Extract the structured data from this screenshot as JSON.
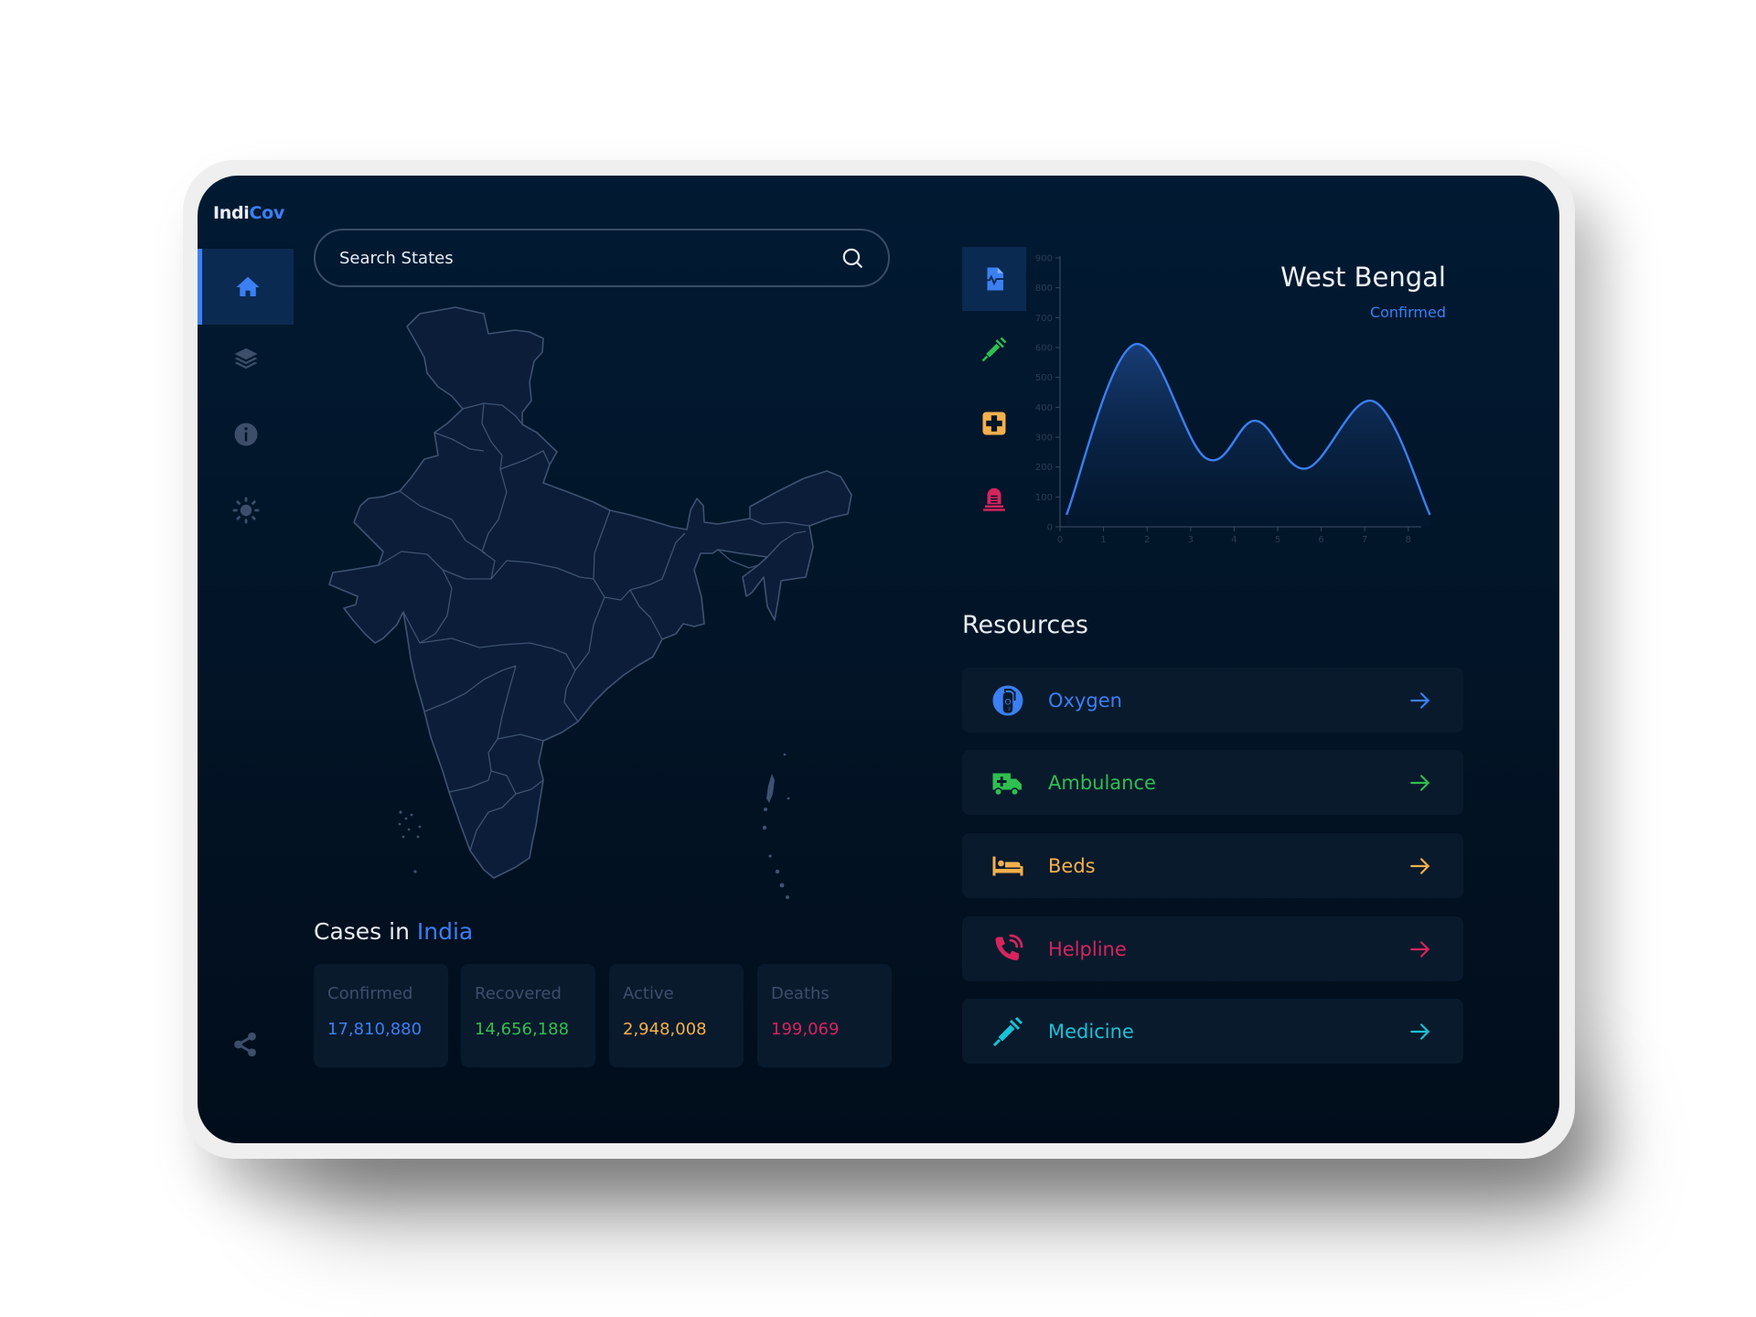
{
  "app": {
    "logo_prefix": "Indi",
    "logo_accent": "Cov"
  },
  "sidebar": {
    "items": [
      {
        "name": "home",
        "icon": "home-icon",
        "active": true
      },
      {
        "name": "layers",
        "icon": "layers-icon",
        "active": false
      },
      {
        "name": "info",
        "icon": "info-icon",
        "active": false
      },
      {
        "name": "theme",
        "icon": "sun-icon",
        "active": false
      }
    ],
    "footer_icon": "share-icon"
  },
  "search": {
    "placeholder": "Search States",
    "value": ""
  },
  "cases": {
    "title_prefix": "Cases in ",
    "title_accent": "India",
    "stats": [
      {
        "label": "Confirmed",
        "value": "17,810,880",
        "color": "#3b7ff2"
      },
      {
        "label": "Recovered",
        "value": "14,656,188",
        "color": "#2fbf4f"
      },
      {
        "label": "Active",
        "value": "2,948,008",
        "color": "#f5b04d"
      },
      {
        "label": "Deaths",
        "value": "199,069",
        "color": "#d6245e"
      }
    ]
  },
  "chart_tabs": [
    {
      "name": "confirmed",
      "icon": "medical-report-icon",
      "color": "#3b7ff2",
      "active": true
    },
    {
      "name": "vaccinated",
      "icon": "syringe-icon",
      "color": "#2fbf4f",
      "active": false
    },
    {
      "name": "active",
      "icon": "first-aid-icon",
      "color": "#f5b04d",
      "active": false
    },
    {
      "name": "deaths",
      "icon": "tombstone-icon",
      "color": "#d6245e",
      "active": false
    }
  ],
  "region": {
    "title": "West Bengal",
    "metric": "Confirmed"
  },
  "chart_data": {
    "type": "area",
    "title": "West Bengal",
    "subtitle": "Confirmed",
    "xlabel": "",
    "ylabel": "",
    "x_ticks": [
      0,
      1,
      2,
      3,
      4,
      5,
      6,
      7,
      8
    ],
    "y_ticks": [
      0,
      100,
      200,
      300,
      400,
      500,
      600,
      700,
      800,
      900
    ],
    "xlim": [
      0,
      8.3
    ],
    "ylim": [
      0,
      900
    ],
    "grid": false,
    "smooth": true,
    "series": [
      {
        "name": "Confirmed",
        "color": "#3b7ff2",
        "x": [
          0.15,
          1.7,
          3.35,
          4.5,
          5.65,
          7.2,
          8.5
        ],
        "y": [
          40,
          610,
          230,
          355,
          195,
          420,
          40
        ]
      }
    ]
  },
  "resources": {
    "title": "Resources",
    "items": [
      {
        "label": "Oxygen",
        "icon": "oxygen-cylinder-icon",
        "color": "#3b7ff2"
      },
      {
        "label": "Ambulance",
        "icon": "ambulance-icon",
        "color": "#2fbf4f"
      },
      {
        "label": "Beds",
        "icon": "bed-icon",
        "color": "#f5b04d"
      },
      {
        "label": "Helpline",
        "icon": "phone-icon",
        "color": "#d6245e"
      },
      {
        "label": "Medicine",
        "icon": "syringe-icon",
        "color": "#19c2d6"
      }
    ]
  }
}
